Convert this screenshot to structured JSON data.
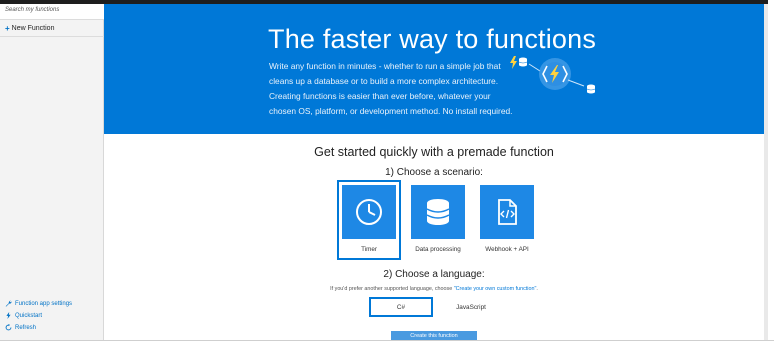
{
  "sidebar": {
    "search_placeholder": "Search my functions",
    "new_function_label": "New Function",
    "links": [
      {
        "label": "Function app settings",
        "icon": "wrench-icon"
      },
      {
        "label": "Quickstart",
        "icon": "lightning-icon"
      },
      {
        "label": "Refresh",
        "icon": "refresh-icon"
      }
    ]
  },
  "hero": {
    "title": "The faster way to functions",
    "description": "Write any function in minutes - whether to run a simple job that cleans up a database or to build a more complex architecture. Creating functions is easier than ever before, whatever your chosen OS, platform, or development method. No install required."
  },
  "main": {
    "heading": "Get started quickly with a premade function",
    "scenario_heading": "1) Choose a scenario:",
    "scenarios": [
      {
        "label": "Timer",
        "icon": "clock-icon",
        "selected": true
      },
      {
        "label": "Data processing",
        "icon": "database-icon",
        "selected": false
      },
      {
        "label": "Webhook + API",
        "icon": "code-file-icon",
        "selected": false
      }
    ],
    "language_heading": "2) Choose a language:",
    "language_note_prefix": "If you'd prefer another supported language, choose",
    "language_note_link": "\"Create your own custom function\"",
    "language_note_suffix": ".",
    "languages": [
      {
        "label": "C#",
        "selected": true
      },
      {
        "label": "JavaScript",
        "selected": false
      }
    ],
    "create_button": "Create this function"
  },
  "colors": {
    "hero_blue": "#0078d7",
    "tile_blue": "#1e88e5",
    "link_blue": "#0072c6",
    "sidebar_bg": "#f3f3f3"
  }
}
